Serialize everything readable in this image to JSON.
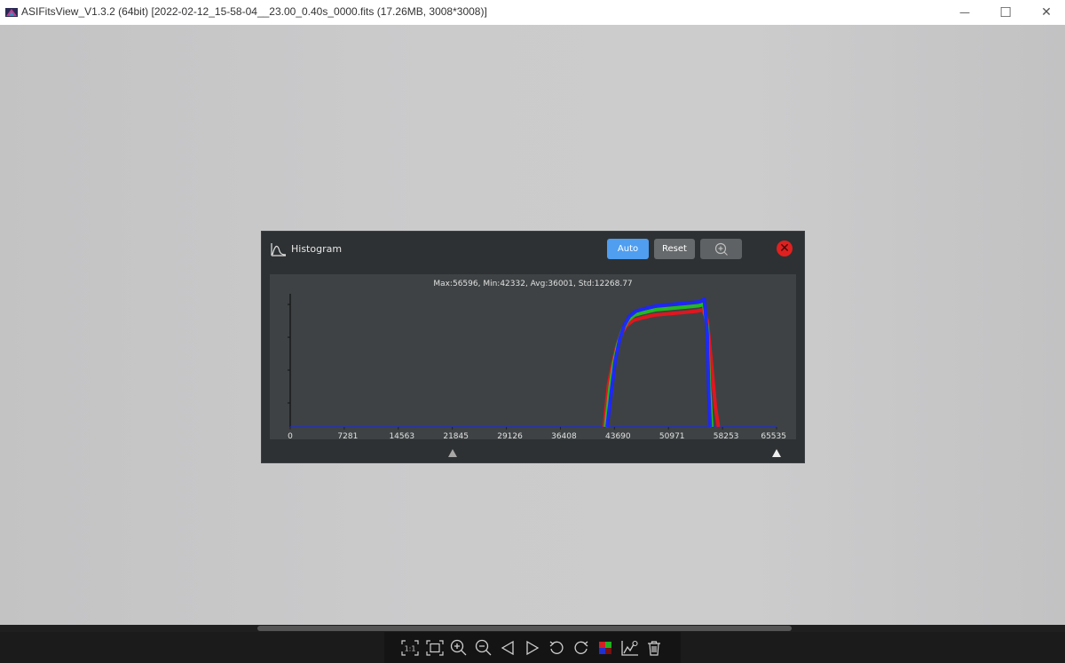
{
  "window": {
    "title": "ASIFitsView_V1.3.2 (64bit) [2022-02-12_15-58-04__23.00_0.40s_0000.fits (17.26MB, 3008*3008)]",
    "controls": {
      "minimize": "—",
      "maximize": "☐",
      "close": "✕"
    }
  },
  "histogram": {
    "title": "Histogram",
    "buttons": {
      "auto": "Auto",
      "reset": "Reset"
    },
    "stats": "Max:56596, Min:42332, Avg:36001, Std:12268.77",
    "x_ticks": [
      "0",
      "7281",
      "14563",
      "21845",
      "29126",
      "36408",
      "43690",
      "50971",
      "58253",
      "65535"
    ],
    "slider": {
      "black_point": 21845,
      "white_point": 65535
    },
    "colors": {
      "red": "#e8141e",
      "green": "#22c022",
      "blue": "#1d24ff",
      "accent": "#4f9ef0",
      "close": "#e02020"
    }
  },
  "chart_data": {
    "type": "line",
    "xlim": [
      0,
      65535
    ],
    "ylim": [
      0,
      1
    ],
    "series": [
      {
        "color": "red",
        "x": [
          42300,
          42900,
          43400,
          44000,
          44600,
          45300,
          46200,
          47500,
          49000,
          51000,
          53000,
          54800,
          55600,
          56200,
          56800,
          57300,
          57700
        ],
        "y": [
          0,
          0.32,
          0.46,
          0.6,
          0.7,
          0.76,
          0.8,
          0.82,
          0.84,
          0.85,
          0.86,
          0.87,
          0.88,
          0.8,
          0.45,
          0.15,
          0
        ]
      },
      {
        "color": "green",
        "x": [
          42500,
          43100,
          43600,
          44200,
          44800,
          45500,
          46400,
          47700,
          49200,
          51200,
          53200,
          55000,
          55700,
          56200,
          56500,
          56800
        ],
        "y": [
          0,
          0.3,
          0.48,
          0.63,
          0.73,
          0.8,
          0.84,
          0.86,
          0.88,
          0.89,
          0.9,
          0.91,
          0.92,
          0.75,
          0.3,
          0
        ]
      },
      {
        "color": "blue",
        "x": [
          42700,
          43300,
          43800,
          44400,
          45000,
          45700,
          46600,
          47900,
          49400,
          51400,
          53400,
          55200,
          55800,
          56200,
          56400,
          56600
        ],
        "y": [
          0,
          0.28,
          0.5,
          0.66,
          0.76,
          0.83,
          0.87,
          0.89,
          0.91,
          0.92,
          0.93,
          0.94,
          0.96,
          0.7,
          0.25,
          0
        ]
      }
    ]
  },
  "toolbar": {
    "icons": [
      "actual-size-icon",
      "fit-screen-icon",
      "zoom-in-icon",
      "zoom-out-icon",
      "previous-icon",
      "next-icon",
      "rotate-left-icon",
      "rotate-right-icon",
      "color-channels-icon",
      "histogram-icon",
      "delete-icon"
    ],
    "actual_size_label": "1:1"
  }
}
